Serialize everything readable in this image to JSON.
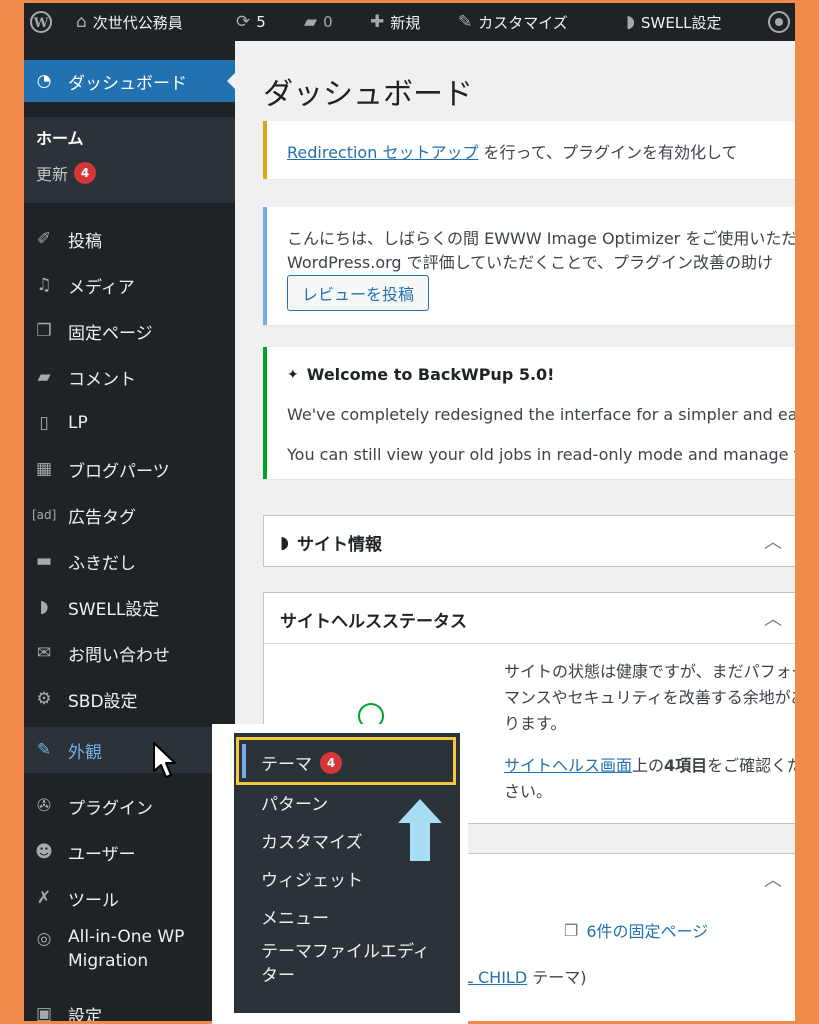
{
  "adminbar": {
    "site_name": "次世代公務員",
    "updates_count": "5",
    "comments_count": "0",
    "new_label": "新規",
    "customize_label": "カスタマイズ",
    "swell_label": "SWELL設定"
  },
  "sidebar": {
    "dashboard": "ダッシュボード",
    "home": "ホーム",
    "updates": "更新",
    "updates_badge": "4",
    "items": [
      {
        "label": "投稿",
        "icon": "pin-icon"
      },
      {
        "label": "メディア",
        "icon": "media-icon"
      },
      {
        "label": "固定ページ",
        "icon": "pages-icon"
      },
      {
        "label": "コメント",
        "icon": "comment-icon"
      },
      {
        "label": "LP",
        "icon": "document-icon"
      },
      {
        "label": "ブログパーツ",
        "icon": "blocks-icon"
      },
      {
        "label": "広告タグ",
        "icon": "ad-icon"
      },
      {
        "label": "ふきだし",
        "icon": "bubble-icon"
      },
      {
        "label": "SWELL設定",
        "icon": "swell-icon"
      },
      {
        "label": "お問い合わせ",
        "icon": "mail-icon"
      },
      {
        "label": "SBD設定",
        "icon": "gear-icon"
      },
      {
        "label": "外観",
        "icon": "brush-icon"
      },
      {
        "label": "プラグイン",
        "icon": "plugin-icon"
      },
      {
        "label": "ユーザー",
        "icon": "user-icon"
      },
      {
        "label": "ツール",
        "icon": "wrench-icon"
      },
      {
        "label": "All-in-One WP Migration",
        "icon": "migration-icon"
      },
      {
        "label": "設定",
        "icon": "settings-icon"
      }
    ],
    "ad_icon_text": "[ad]"
  },
  "main": {
    "title": "ダッシュボード",
    "notice1": {
      "link": "Redirection セットアップ",
      "text": " を行って、プラグインを有効化して"
    },
    "notice2": {
      "line1": "こんにちは、しばらくの間 EWWW Image Optimizer をご使用いただ",
      "line2": "WordPress.org で評価していただくことで、プラグイン改善の助け",
      "button": "レビューを投稿"
    },
    "notice3": {
      "title": "Welcome to BackWPup 5.0!",
      "line1": "We've completely redesigned the interface for a simpler and easier",
      "line2": "You can still view your old jobs in read-only mode and manage them"
    },
    "box_site_info": "サイト情報",
    "box_health": {
      "title": "サイトヘルスステータス",
      "line1": "サイトの状態は健康ですが、まだパフォー",
      "line2": "マンスやセキュリティを改善する余地があ",
      "line3": "ります。",
      "link": "サイトヘルス画面",
      "text_a": "上の",
      "bold": "4項目",
      "text_b": "をご確認くだ",
      "line5": "さい。"
    },
    "box_glance": {
      "pages": "6件の固定ページ",
      "theme_link": "L CHILD",
      "theme_text": " テーマ)"
    }
  },
  "flyout": {
    "items": [
      "テーマ",
      "パターン",
      "カスタマイズ",
      "ウィジェット",
      "メニュー",
      "テーマファイルエディ",
      "ター"
    ],
    "theme_badge": "4"
  },
  "colors": {
    "highlight": "#f5c842",
    "arrow": "#a8dcf5",
    "accent": "#2271b1"
  }
}
